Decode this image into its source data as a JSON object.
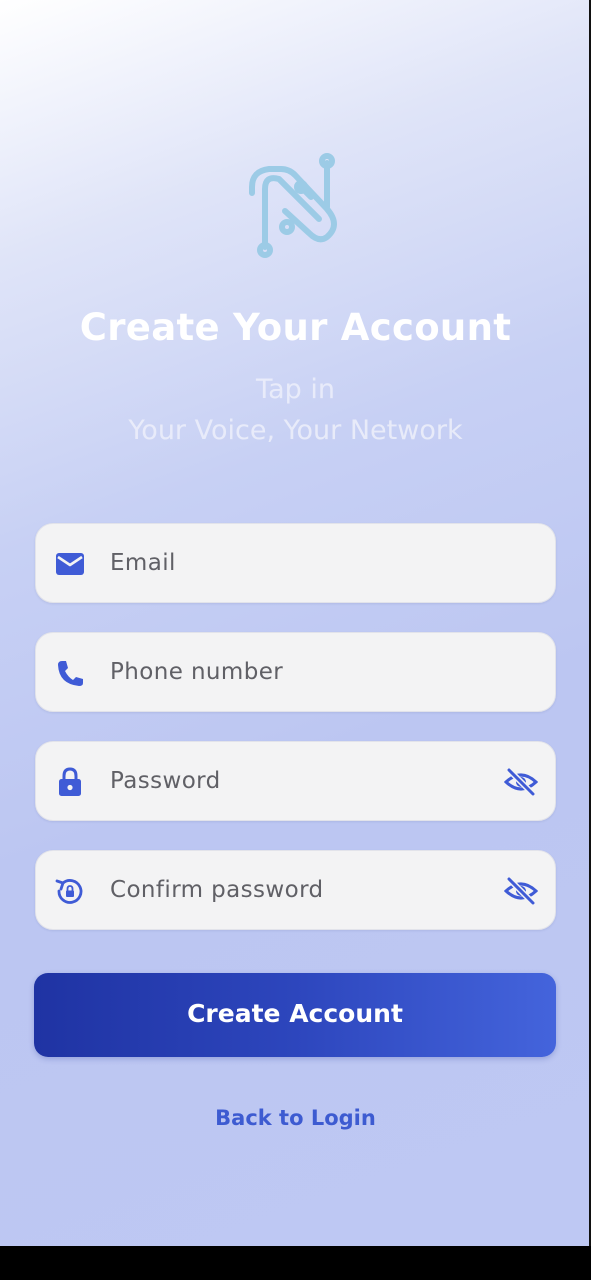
{
  "app": {
    "title": "Create Your Account",
    "tagline_line1": "Tap in",
    "tagline_line2": "Your Voice, Your Network"
  },
  "form": {
    "email": {
      "placeholder": "Email",
      "icon": "mail-icon"
    },
    "phone": {
      "placeholder": "Phone number",
      "icon": "phone-icon"
    },
    "password": {
      "placeholder": "Password",
      "icon": "lock-icon",
      "toggle_icon": "eye-off-icon"
    },
    "confirm_password": {
      "placeholder": "Confirm password",
      "icon": "lock-reset-icon",
      "toggle_icon": "eye-off-icon"
    }
  },
  "actions": {
    "create_account_label": "Create Account",
    "back_to_login_label": "Back to Login"
  },
  "colors": {
    "accent": "#3f5bd6",
    "button_start": "#1f33a3",
    "button_end": "#4464dc",
    "logo": "#9ccbe6",
    "field_bg": "#f3f3f4"
  }
}
